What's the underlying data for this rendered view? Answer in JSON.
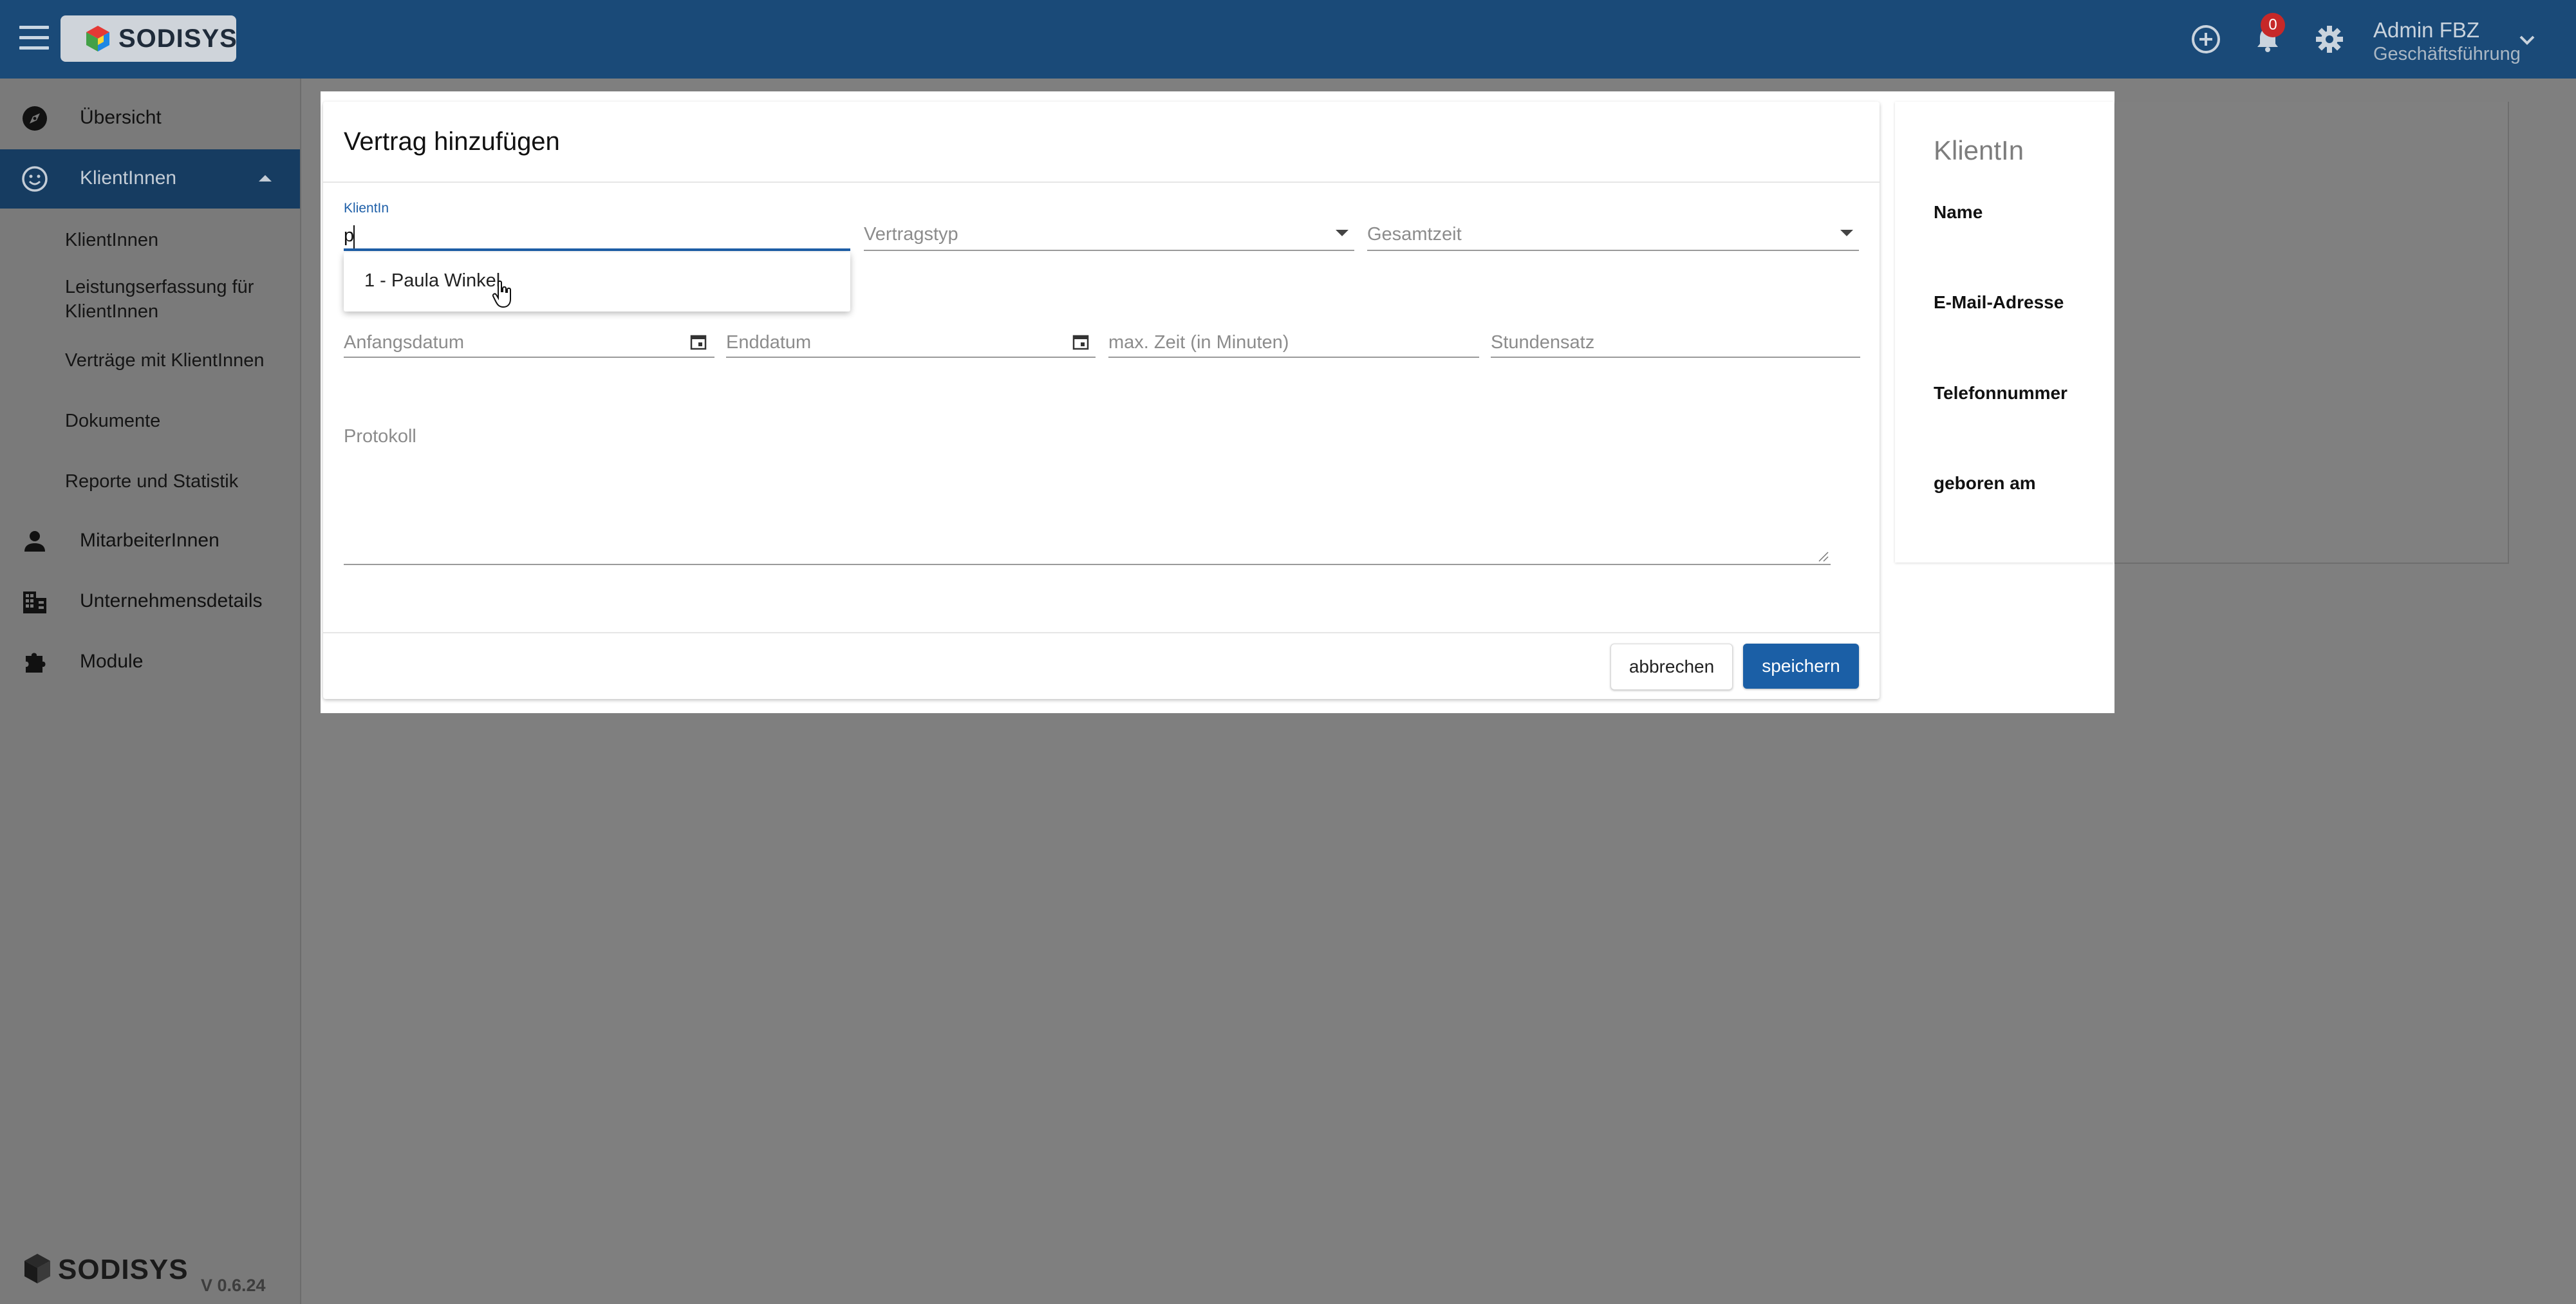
{
  "topbar": {
    "logo_text": "SODISYS",
    "notifications_count": "0",
    "user_name": "Admin FBZ",
    "user_role": "Geschäftsführung"
  },
  "sidebar": {
    "items": [
      {
        "label": "Übersicht",
        "icon": "compass-icon"
      },
      {
        "label": "KlientInnen",
        "icon": "smiley-icon"
      },
      {
        "label": "MitarbeiterInnen",
        "icon": "person-icon"
      },
      {
        "label": "Unternehmensdetails",
        "icon": "building-icon"
      },
      {
        "label": "Module",
        "icon": "puzzle-icon"
      }
    ],
    "sub_items": [
      "KlientInnen",
      "Leistungserfassung für KlientInnen",
      "Verträge mit KlientInnen",
      "Dokumente",
      "Reporte und Statistik"
    ],
    "footer_logo": "SODISYS",
    "version": "V 0.6.24"
  },
  "dialog": {
    "title": "Vertrag hinzufügen",
    "client_label": "KlientIn",
    "client_value": "p",
    "contract_type_placeholder": "Vertragstyp",
    "total_time_placeholder": "Gesamtzeit",
    "start_date_placeholder": "Anfangsdatum",
    "end_date_placeholder": "Enddatum",
    "max_time_placeholder": "max. Zeit (in Minuten)",
    "hourly_rate_placeholder": "Stundensatz",
    "protocol_placeholder": "Protokoll",
    "autocomplete_option": "1 - Paula Winkel",
    "cancel_label": "abbrechen",
    "save_label": "speichern"
  },
  "info_panel": {
    "title": "KlientIn",
    "name_label": "Name",
    "email_label": "E-Mail-Adresse",
    "phone_label": "Telefonnummer",
    "birth_label": "geboren am"
  },
  "colors": {
    "topbar": "#1a4a78",
    "active_nav": "#163c61",
    "primary": "#1b5fa6",
    "overlay": "#7f7f7f"
  }
}
